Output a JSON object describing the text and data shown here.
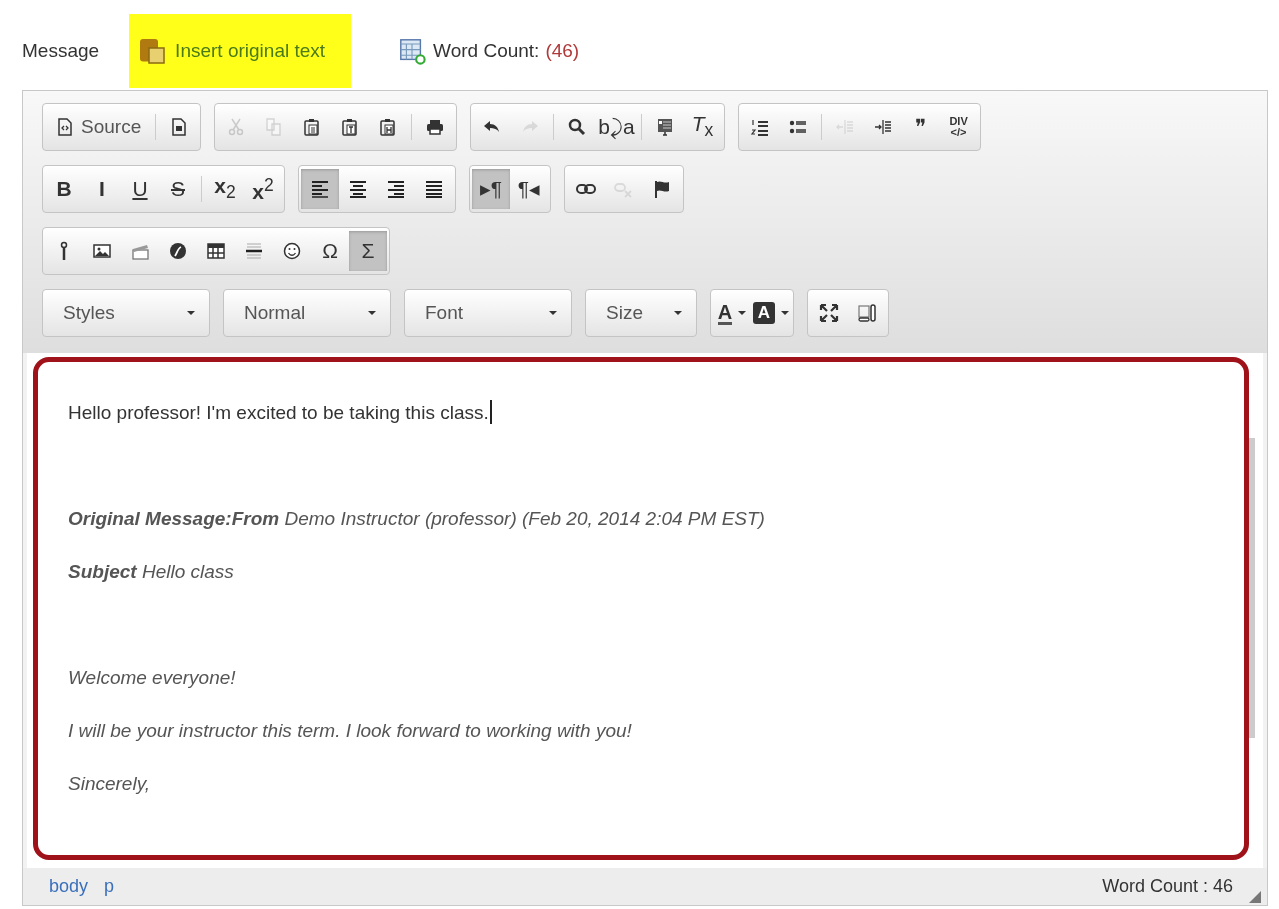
{
  "header": {
    "label": "Message",
    "insert_link": {
      "text": "Insert original text",
      "highlighted": true
    },
    "word_count": {
      "label": "Word Count:",
      "value": "(46)"
    }
  },
  "toolbar": {
    "rows": [
      {
        "groups": [
          {
            "buttons": [
              {
                "kind": "icon-label",
                "label": "Source",
                "disabled": false,
                "selected": false
              },
              {
                "kind": "separator"
              },
              {
                "kind": "icon",
                "disabled": false,
                "selected": false
              }
            ]
          },
          {
            "buttons": [
              {
                "kind": "icon",
                "disabled": true,
                "selected": false
              },
              {
                "kind": "icon",
                "disabled": true,
                "selected": false
              },
              {
                "kind": "icon",
                "disabled": false,
                "selected": false
              },
              {
                "kind": "icon",
                "disabled": false,
                "selected": false
              },
              {
                "kind": "icon",
                "disabled": false,
                "selected": false
              },
              {
                "kind": "separator"
              },
              {
                "kind": "icon",
                "disabled": false,
                "selected": false
              }
            ]
          },
          {
            "buttons": [
              {
                "kind": "icon",
                "disabled": false,
                "selected": false
              },
              {
                "kind": "icon",
                "disabled": true,
                "selected": false
              },
              {
                "kind": "separator"
              },
              {
                "kind": "icon",
                "disabled": false,
                "selected": false
              },
              {
                "kind": "glyph",
                "label": "b⤸a",
                "disabled": false,
                "selected": false
              },
              {
                "kind": "separator"
              },
              {
                "kind": "icon",
                "disabled": false,
                "selected": false
              },
              {
                "kind": "glyph",
                "label": "*T*$_{x}$",
                "disabled": false,
                "selected": false
              }
            ]
          },
          {
            "buttons": [
              {
                "kind": "icon",
                "disabled": false,
                "selected": false
              },
              {
                "kind": "icon",
                "disabled": false,
                "selected": false
              },
              {
                "kind": "separator"
              },
              {
                "kind": "icon",
                "disabled": true,
                "selected": false
              },
              {
                "kind": "icon",
                "disabled": false,
                "selected": false
              },
              {
                "kind": "glyph",
                "label": "❞",
                "disabled": false,
                "selected": false
              },
              {
                "kind": "glyph",
                "label": "DIV",
                "sublabel": "</>",
                "disabled": false,
                "selected": false
              }
            ]
          }
        ]
      },
      {
        "groups": [
          {
            "buttons": [
              {
                "kind": "glyph",
                "label": "**B**",
                "disabled": false,
                "selected": false
              },
              {
                "kind": "glyph",
                "label": "**I**",
                "disabled": false,
                "selected": false
              },
              {
                "kind": "underline",
                "label": "U",
                "disabled": false,
                "selected": false
              },
              {
                "kind": "strike",
                "label": "S",
                "disabled": false,
                "selected": false
              },
              {
                "kind": "separator"
              },
              {
                "kind": "glyph",
                "label": "**x**$_{2}$",
                "disabled": false,
                "selected": false
              },
              {
                "kind": "glyph",
                "label": "**x**$^{2}$",
                "disabled": false,
                "selected": false
              }
            ]
          },
          {
            "buttons": [
              {
                "kind": "icon",
                "disabled": false,
                "selected": true
              },
              {
                "kind": "icon",
                "disabled": false,
                "selected": false
              },
              {
                "kind": "icon",
                "disabled": false,
                "selected": false
              },
              {
                "kind": "icon",
                "disabled": false,
                "selected": false
              }
            ]
          },
          {
            "buttons": [
              {
                "kind": "glyph",
                "label": "▸¶",
                "disabled": false,
                "selected": true
              },
              {
                "kind": "glyph",
                "label": "¶◂",
                "disabled": false,
                "selected": false
              }
            ]
          },
          {
            "buttons": [
              {
                "kind": "icon",
                "disabled": false,
                "selected": false
              },
              {
                "kind": "icon",
                "disabled": true,
                "selected": false
              },
              {
                "kind": "icon",
                "disabled": false,
                "selected": false
              }
            ]
          }
        ]
      },
      {
        "groups": [
          {
            "buttons": [
              {
                "kind": "icon",
                "disabled": false,
                "selected": false
              },
              {
                "kind": "icon",
                "disabled": false,
                "selected": false
              },
              {
                "kind": "icon",
                "disabled": false,
                "selected": false
              },
              {
                "kind": "icon",
                "disabled": false,
                "selected": false
              },
              {
                "kind": "icon",
                "disabled": false,
                "selected": false
              },
              {
                "kind": "icon",
                "disabled": false,
                "selected": false
              },
              {
                "kind": "icon",
                "disabled": false,
                "selected": false
              },
              {
                "kind": "glyph",
                "label": "Ω",
                "disabled": false,
                "selected": false
              },
              {
                "kind": "glyph",
                "label": "Σ",
                "disabled": false,
                "selected": true
              }
            ]
          }
        ]
      },
      {
        "groups": [
          {
            "buttons": [
              {
                "kind": "combo",
                "label": "Styles"
              }
            ]
          },
          {
            "buttons": [
              {
                "kind": "combo",
                "label": "Normal"
              }
            ]
          },
          {
            "buttons": [
              {
                "kind": "combo",
                "label": "Font"
              }
            ]
          },
          {
            "buttons": [
              {
                "kind": "combo",
                "label": "Size"
              }
            ]
          },
          {
            "buttons": [
              {
                "kind": "textcolor",
                "label": "A",
                "disabled": false,
                "selected": false
              },
              {
                "kind": "bgcolor",
                "label": "A",
                "disabled": false,
                "selected": false
              }
            ]
          },
          {
            "buttons": [
              {
                "kind": "icon",
                "disabled": false,
                "selected": false
              },
              {
                "kind": "icon",
                "disabled": false,
                "selected": false
              }
            ]
          }
        ]
      }
    ]
  },
  "editor": {
    "paragraphs": [
      {
        "kind": "typed",
        "text": "Hello professor! I'm excited to be taking this class.",
        "caret": true
      },
      {
        "kind": "spacer"
      },
      {
        "kind": "quoted",
        "text": "**Original Message:From** Demo Instructor (professor) (Feb 20, 2014 2:04 PM EST)"
      },
      {
        "kind": "quoted",
        "text": "**Subject** Hello class"
      },
      {
        "kind": "spacer"
      },
      {
        "kind": "quoted",
        "text": "Welcome everyone!"
      },
      {
        "kind": "quoted",
        "text": "I will be your instructor this term. I look forward to working with you!"
      },
      {
        "kind": "quoted",
        "text": "Sincerely,"
      }
    ],
    "outlined": true
  },
  "status_bar": {
    "path": [
      "body",
      "p"
    ],
    "word_count": "Word Count : 46"
  }
}
